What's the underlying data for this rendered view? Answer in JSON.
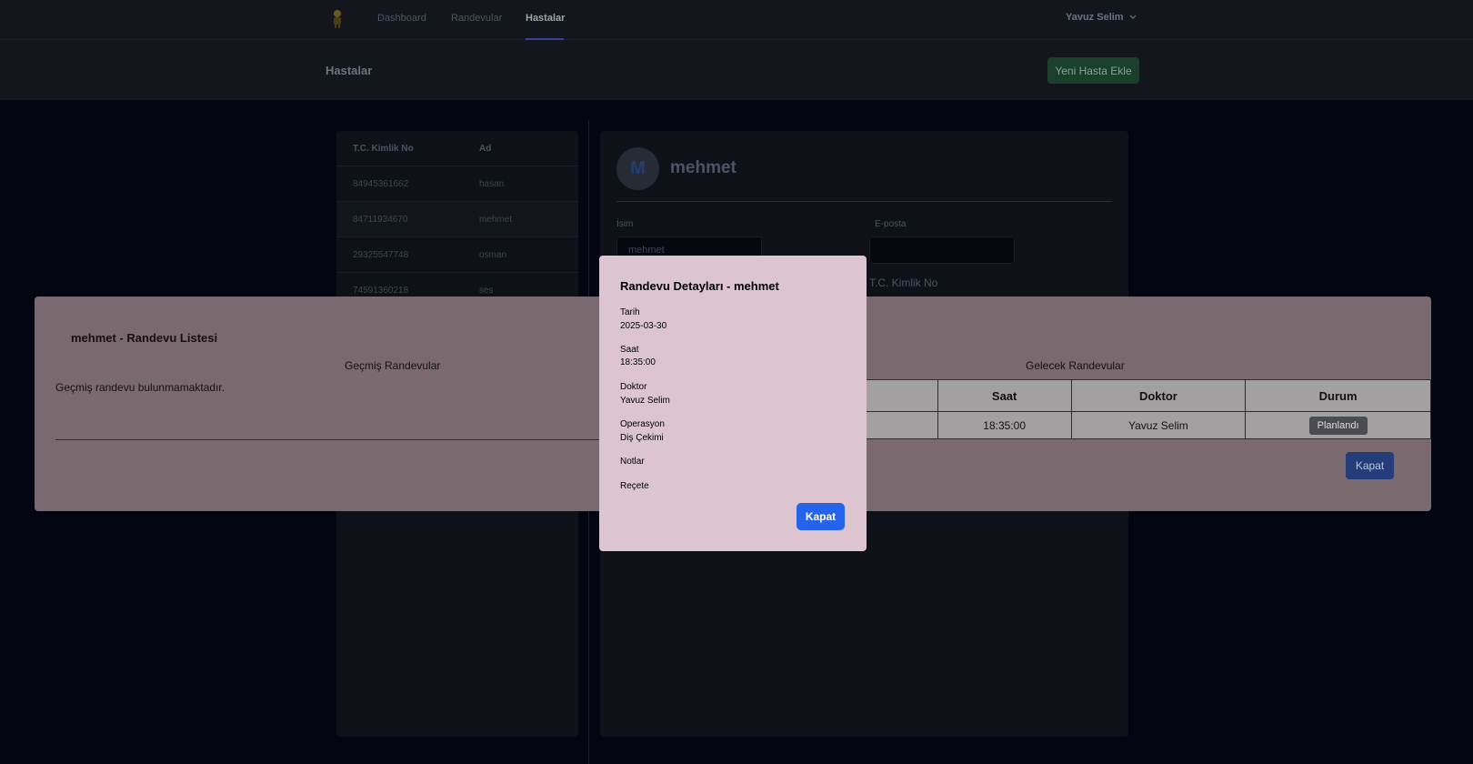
{
  "nav": {
    "items": [
      {
        "label": "Dashboard"
      },
      {
        "label": "Randevular"
      },
      {
        "label": "Hastalar"
      }
    ],
    "user_name": "Yavuz Selim"
  },
  "subheader": {
    "title": "Hastalar",
    "new_patient_label": "Yeni Hasta Ekle"
  },
  "patients": {
    "columns": [
      "T.C. Kimlik No",
      "Ad"
    ],
    "rows": [
      {
        "tc": "84945361662",
        "name": "hasan"
      },
      {
        "tc": "84711934670",
        "name": "mehmet"
      },
      {
        "tc": "29325547748",
        "name": "osman"
      },
      {
        "tc": "74591360218",
        "name": "ses"
      }
    ]
  },
  "detail": {
    "avatar_initial": "M",
    "name": "mehmet",
    "name_label": "İsim",
    "name_value": "mehmet",
    "email_label": "E-posta",
    "email_value": "",
    "tc_label": "T.C. Kimlik No"
  },
  "appointment_list_modal": {
    "title": "mehmet - Randevu Listesi",
    "past_title": "Geçmiş Randevular",
    "past_empty": "Geçmiş randevu bulunmamaktadır.",
    "future_title": "Gelecek Randevular",
    "columns": [
      "Saat",
      "Doktor",
      "Durum"
    ],
    "rows": [
      {
        "saat": "18:35:00",
        "doktor": "Yavuz Selim",
        "durum": "Planlandı"
      }
    ],
    "close_label": "Kapat"
  },
  "appointment_detail_modal": {
    "title": "Randevu Detayları - mehmet",
    "fields": [
      {
        "label": "Tarih",
        "value": "2025-03-30"
      },
      {
        "label": "Saat",
        "value": "18:35:00"
      },
      {
        "label": "Doktor",
        "value": "Yavuz Selim"
      },
      {
        "label": "Operasyon",
        "value": "Diş Çekimi"
      },
      {
        "label": "Notlar",
        "value": ""
      },
      {
        "label": "Reçete",
        "value": ""
      }
    ],
    "close_label": "Kapat"
  },
  "colors": {
    "accent": "#2563eb",
    "success": "#1a3f2a",
    "modal_bg": "#dcc4d0"
  }
}
